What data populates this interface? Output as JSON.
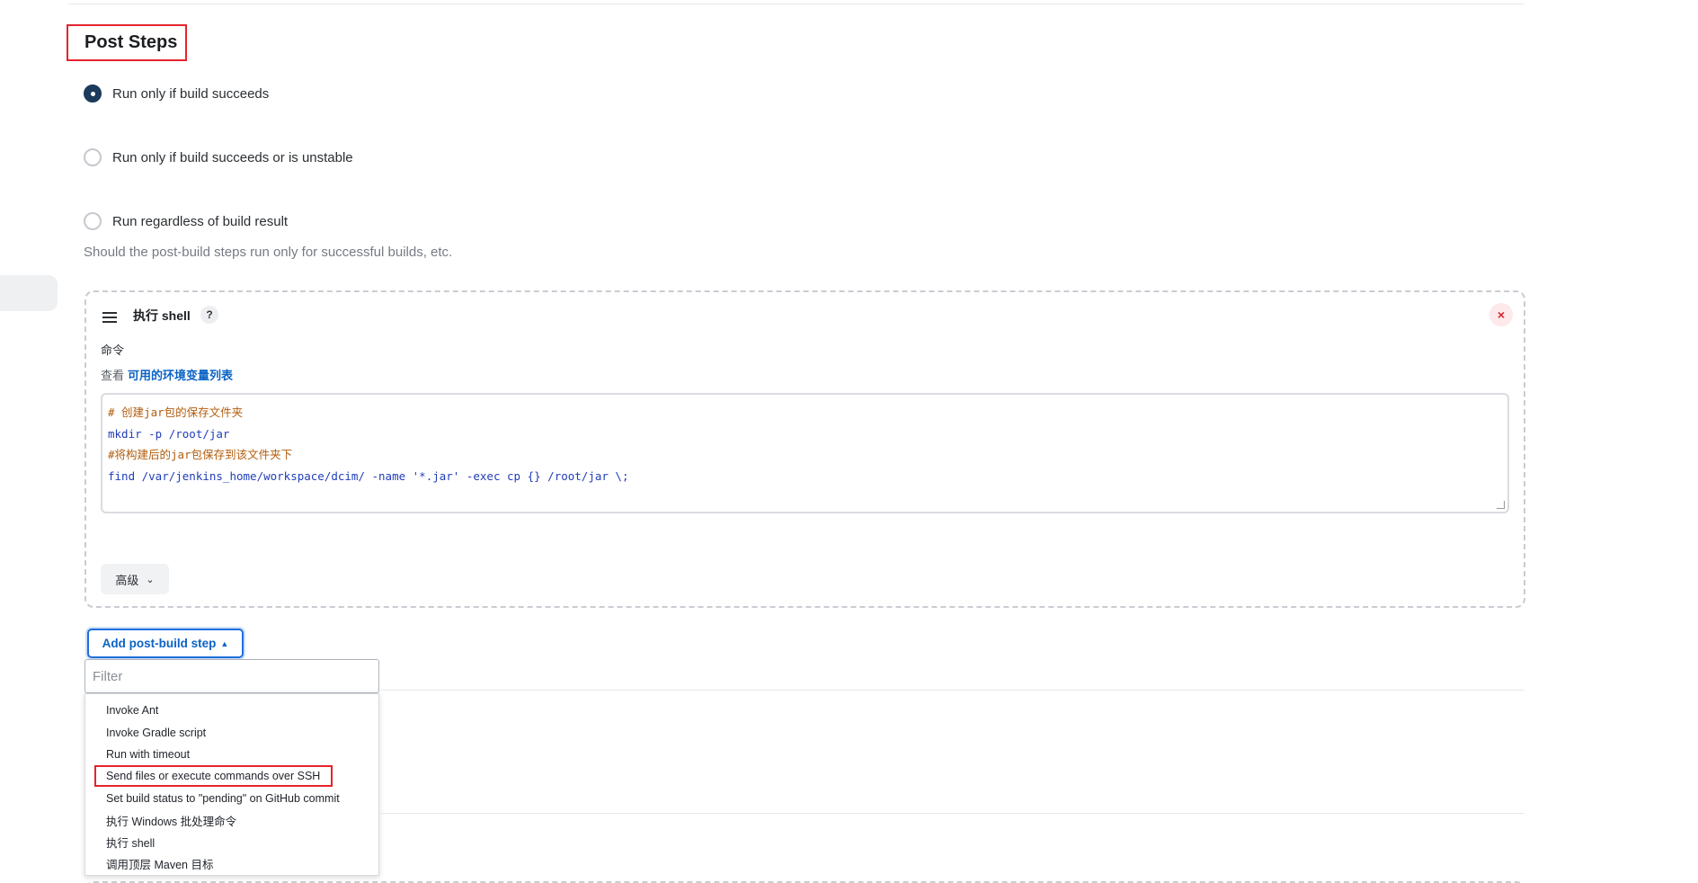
{
  "post_steps": {
    "title": "Post Steps",
    "options": [
      {
        "label": "Run only if build succeeds",
        "checked": true
      },
      {
        "label": "Run only if build succeeds or is unstable",
        "checked": false
      },
      {
        "label": "Run regardless of build result",
        "checked": false
      }
    ],
    "help": "Should the post-build steps run only for successful builds, etc."
  },
  "shell_step": {
    "title": "执行 shell",
    "help_mark": "?",
    "close_glyph": "×",
    "command_label": "命令",
    "env_prefix": "查看",
    "env_link": "可用的环境变量列表",
    "code_lines": [
      "# 创建jar包的保存文件夹",
      "mkdir -p /root/jar",
      "#将构建后的jar包保存到该文件夹下",
      "find /var/jenkins_home/workspace/dcim/ -name '*.jar' -exec cp {} /root/jar \\;"
    ],
    "advanced_label": "高级"
  },
  "add_step": {
    "label": "Add post-build step",
    "filter_placeholder": "Filter",
    "menu_items": [
      "Invoke Ant",
      "Invoke Gradle script",
      "Run with timeout",
      "Send files or execute commands over SSH",
      "Set build status to \"pending\" on GitHub commit",
      "执行 Windows 批处理命令",
      "执行 shell",
      "调用顶层 Maven 目标"
    ],
    "highlighted_item": "Send files or execute commands over SSH"
  },
  "colors": {
    "highlight_border": "#e5232c",
    "link_blue": "#0b63c5",
    "radio_checked": "#1b3a5c"
  }
}
